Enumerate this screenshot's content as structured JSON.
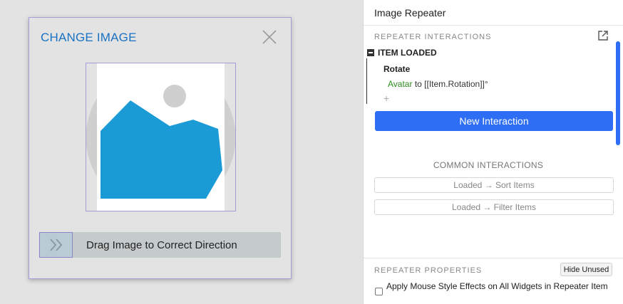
{
  "canvas": {
    "card_title": "CHANGE IMAGE",
    "drag_label": "Drag Image to Correct Direction",
    "colors": {
      "accent": "#1a72c4",
      "image_fill": "#1a9bd5",
      "circle_gray": "#cfcfcf"
    }
  },
  "panel": {
    "title": "Image Repeater",
    "interactions": {
      "section_label": "REPEATER INTERACTIONS",
      "event": "ITEM LOADED",
      "action": "Rotate",
      "target": "Avatar",
      "detail": "to [[Item.Rotation]]°",
      "add_symbol": "+",
      "new_button": "New Interaction"
    },
    "common": {
      "label": "COMMON INTERACTIONS",
      "items": [
        "Loaded → Sort Items",
        "Loaded → Filter Items"
      ]
    },
    "properties": {
      "section_label": "REPEATER PROPERTIES",
      "hide_button": "Hide Unused",
      "checkbox_label": "Apply Mouse Style Effects on All Widgets in Repeater Item",
      "checkbox_checked": false
    },
    "colors": {
      "primary": "#2d6ef5",
      "target_green": "#2e8b1e"
    }
  }
}
